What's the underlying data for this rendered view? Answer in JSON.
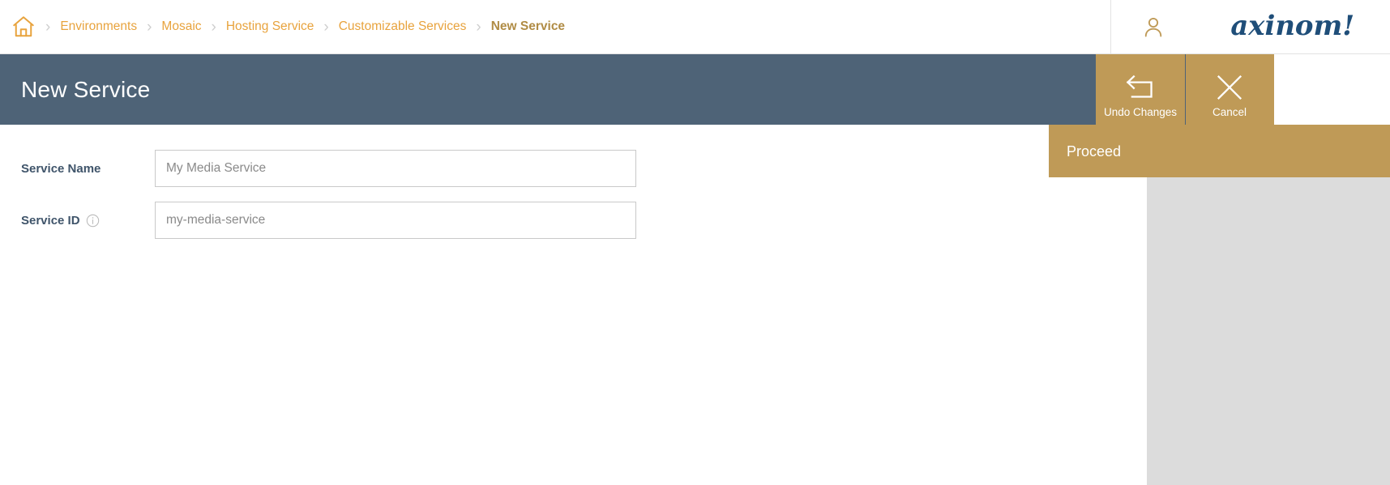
{
  "breadcrumb": {
    "home_icon": "home-icon",
    "separator": "chevron-right-icon",
    "items": [
      {
        "label": "Environments",
        "current": false
      },
      {
        "label": "Mosaic",
        "current": false
      },
      {
        "label": "Hosting Service",
        "current": false
      },
      {
        "label": "Customizable Services",
        "current": false
      },
      {
        "label": "New Service",
        "current": true
      }
    ]
  },
  "topbar": {
    "user_icon": "user-account-icon",
    "brand": "axinom!"
  },
  "header": {
    "title": "New Service"
  },
  "actions": [
    {
      "label": "Undo Changes",
      "icon": "undo-arrow-icon"
    },
    {
      "label": "Cancel",
      "icon": "close-x-icon"
    }
  ],
  "proceed": {
    "label": "Proceed"
  },
  "form": {
    "fields": [
      {
        "label": "Service Name",
        "value": "",
        "placeholder": "My Media Service",
        "has_info": false
      },
      {
        "label": "Service ID",
        "value": "",
        "placeholder": "my-media-service",
        "has_info": true,
        "info_icon": "info-circle-icon"
      }
    ]
  },
  "colors": {
    "accent_gold": "#bf9a57",
    "breadcrumb_link": "#e8a33d",
    "breadcrumb_current": "#b08c45",
    "header_slate": "#4e6377",
    "panel_gray": "#dcdcdc",
    "brand_blue": "#1f4e79"
  }
}
